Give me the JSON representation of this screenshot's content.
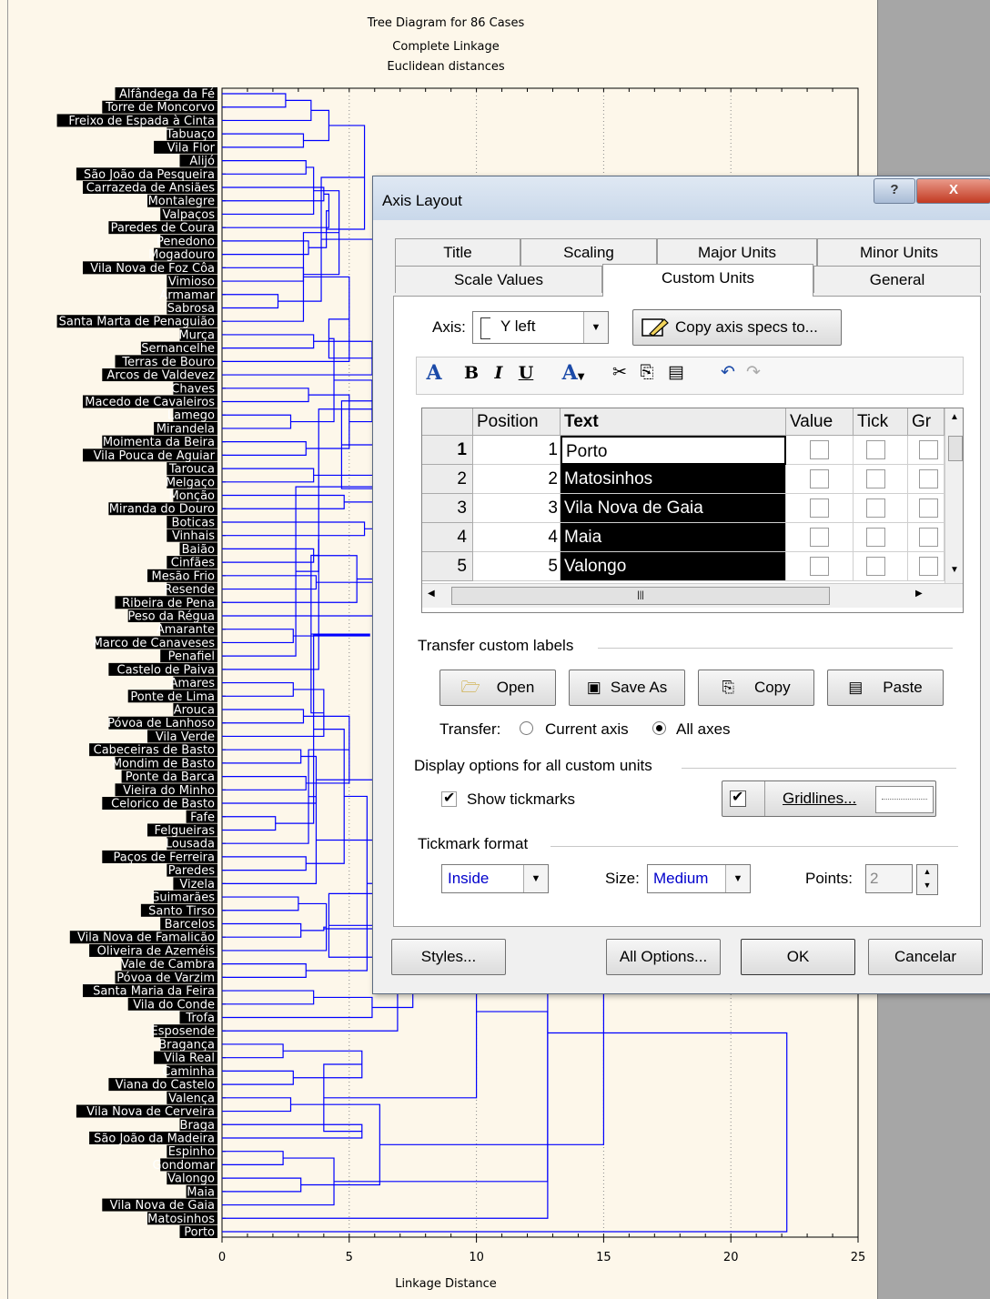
{
  "plot": {
    "title": "Tree Diagram for 86 Cases",
    "subtitle1": "Complete Linkage",
    "subtitle2": "Euclidean distances",
    "xlabel": "Linkage Distance",
    "xticks": [
      "0",
      "5",
      "10",
      "15",
      "20",
      "25"
    ],
    "xlim": [
      0,
      25
    ],
    "line_color": "#0000ff",
    "leaves": [
      "Alfândega da Fé",
      "Torre de Moncorvo",
      "Freixo de Espada à Cinta",
      "Tabuaço",
      "Vila Flor",
      "Alijó",
      "São João da Pesqueira",
      "Carrazeda de Ansiães",
      "Montalegre",
      "Valpaços",
      "Paredes de Coura",
      "Penedono",
      "Mogadouro",
      "Vila Nova de Foz Côa",
      "Vimioso",
      "Armamar",
      "Sabrosa",
      "Santa Marta de Penaguião",
      "Murça",
      "Sernancelhe",
      "Terras de Bouro",
      "Arcos de Valdevez",
      "Chaves",
      "Macedo de Cavaleiros",
      "Lamego",
      "Mirandela",
      "Moimenta da Beira",
      "Vila Pouca de Aguiar",
      "Tarouca",
      "Melgaço",
      "Monção",
      "Miranda do Douro",
      "Boticas",
      "Vinhais",
      "Baião",
      "Cinfães",
      "Mesão Frio",
      "Resende",
      "Ribeira de Pena",
      "Peso da Régua",
      "Amarante",
      "Marco de Canaveses",
      "Penafiel",
      "Castelo de Paiva",
      "Amares",
      "Ponte de Lima",
      "Arouca",
      "Póvoa de Lanhoso",
      "Vila Verde",
      "Cabeceiras de Basto",
      "Mondim de Basto",
      "Ponte da Barca",
      "Vieira do Minho",
      "Celorico de Basto",
      "Fafe",
      "Felgueiras",
      "Lousada",
      "Paços de Ferreira",
      "Paredes",
      "Vizela",
      "Guimarães",
      "Santo Tirso",
      "Barcelos",
      "Vila Nova de Famalicão",
      "Oliveira de Azeméis",
      "Vale de Cambra",
      "Póvoa de Varzim",
      "Santa Maria da Feira",
      "Vila do Conde",
      "Trofa",
      "Esposende",
      "Bragança",
      "Vila Real",
      "Caminha",
      "Viana do Castelo",
      "Valença",
      "Vila Nova de Cerveira",
      "Braga",
      "São João da Madeira",
      "Espinho",
      "Gondomar",
      "Valongo",
      "Maia",
      "Vila Nova de Gaia",
      "Matosinhos",
      "Porto"
    ]
  },
  "dialog": {
    "title": "Axis Layout",
    "help_glyph": "?",
    "close_glyph": "X",
    "tabs_row1": [
      "Title",
      "Scaling",
      "Major Units",
      "Minor Units"
    ],
    "tabs_row2": [
      "Scale Values",
      "Custom Units",
      "General"
    ],
    "axis_label": "Axis:",
    "axis_value": "Y left",
    "copy_specs": "Copy axis specs to...",
    "grid": {
      "headers": [
        "Position",
        "Text",
        "Value",
        "Tick",
        "Gr"
      ],
      "rows": [
        {
          "n": "1",
          "pos": "1",
          "text": "Porto"
        },
        {
          "n": "2",
          "pos": "2",
          "text": "Matosinhos"
        },
        {
          "n": "3",
          "pos": "3",
          "text": "Vila Nova de Gaia"
        },
        {
          "n": "4",
          "pos": "4",
          "text": "Maia"
        },
        {
          "n": "5",
          "pos": "5",
          "text": "Valongo"
        }
      ]
    },
    "transfer_group": "Transfer custom labels",
    "open": "Open",
    "save_as": "Save As",
    "copy": "Copy",
    "paste": "Paste",
    "transfer_label": "Transfer:",
    "current_axis": "Current axis",
    "all_axes": "All axes",
    "display_group": "Display options for all custom units",
    "show_tickmarks": "Show tickmarks",
    "gridlines": "Gridlines...",
    "tickmark_group": "Tickmark format",
    "tick_style": "Inside",
    "size_label": "Size:",
    "size_value": "Medium",
    "points_label": "Points:",
    "points_value": "2",
    "styles": "Styles...",
    "all_options": "All Options...",
    "ok": "OK",
    "cancel": "Cancelar"
  }
}
